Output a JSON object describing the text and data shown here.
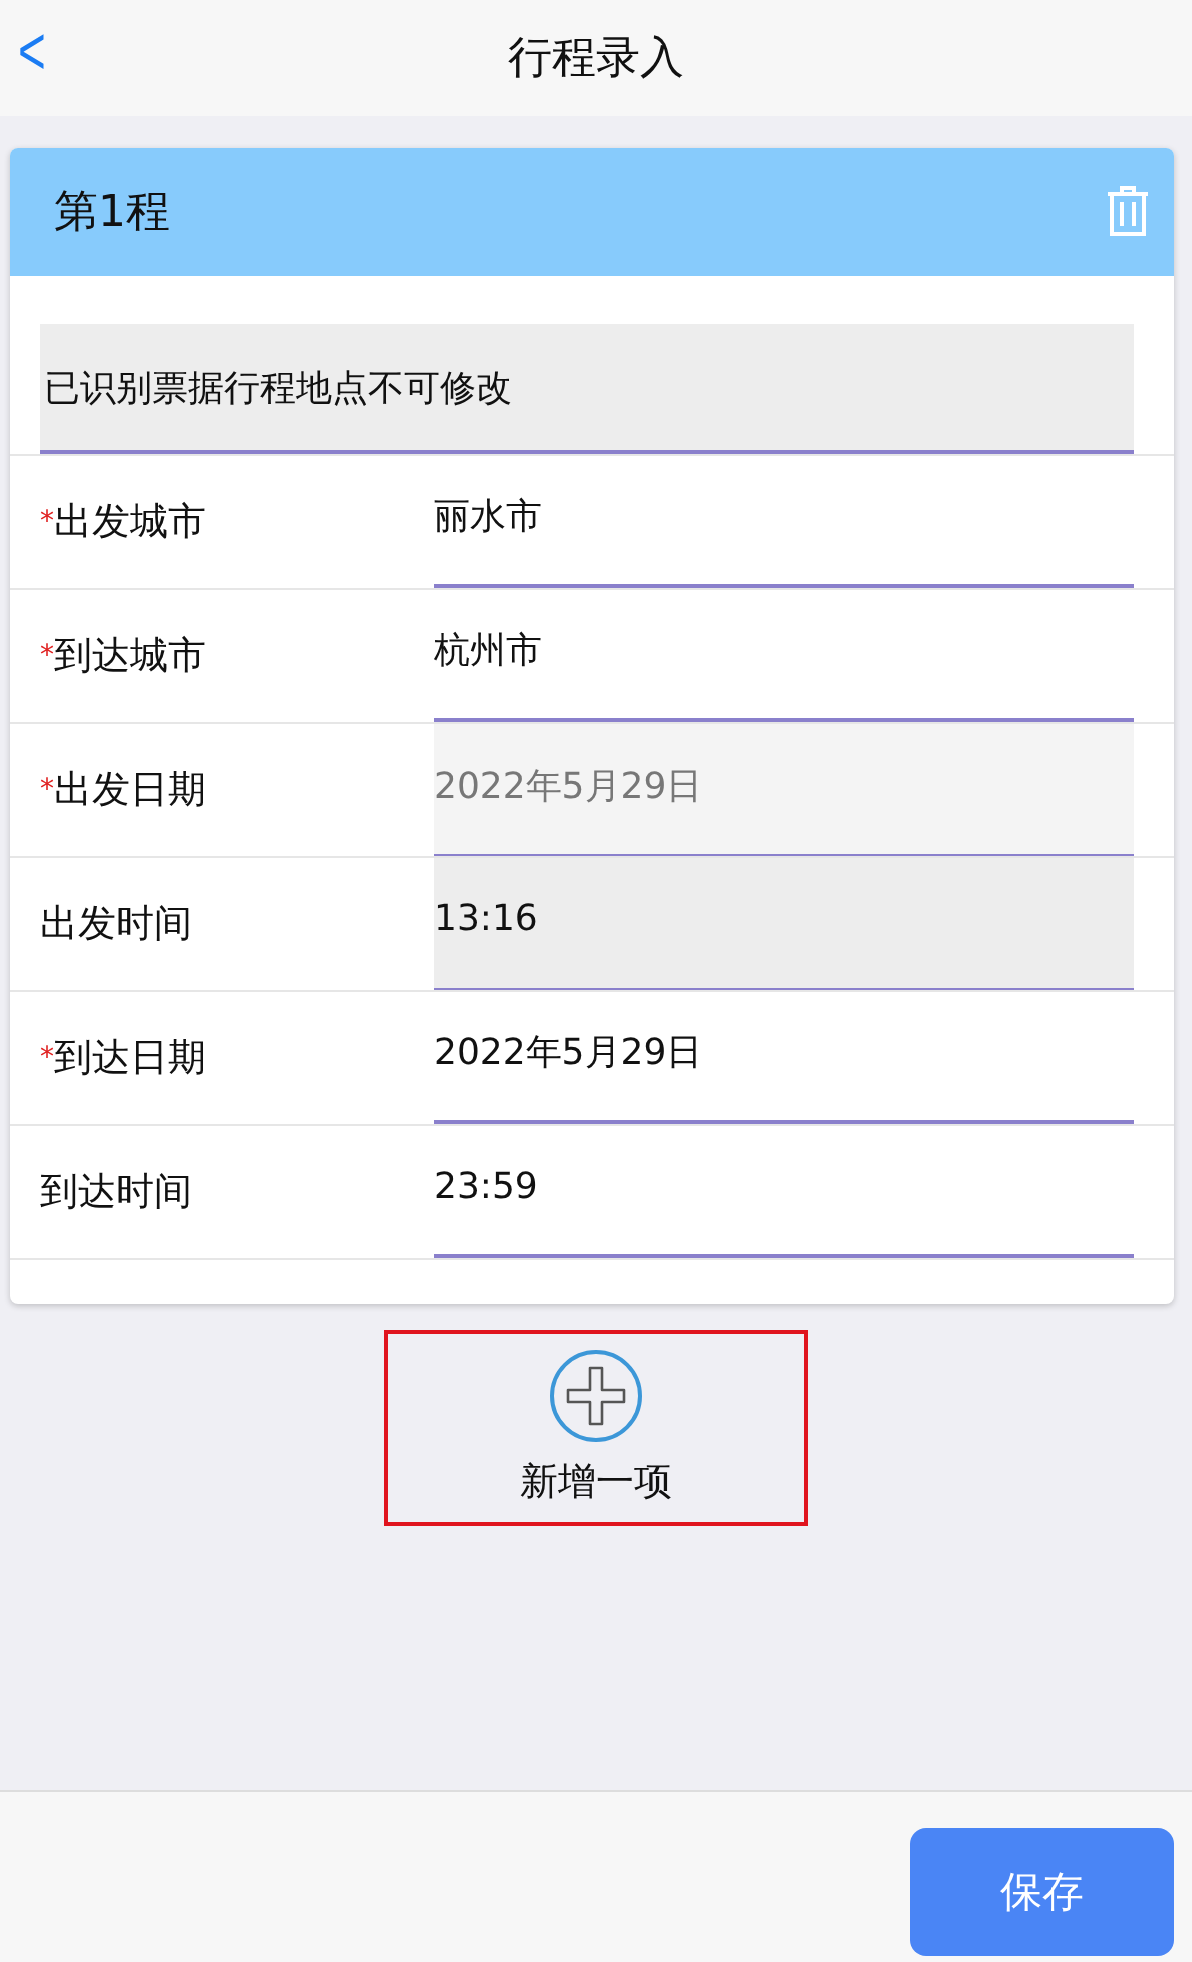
{
  "nav": {
    "back": "<",
    "title": "行程录入"
  },
  "trip": {
    "title": "第1程",
    "notice": "已识别票据行程地点不可修改",
    "fields": [
      {
        "marker": "*",
        "label": "出发城市",
        "value": "丽水市",
        "disabled": false,
        "locked": false
      },
      {
        "marker": "*",
        "label": "到达城市",
        "value": "杭州市",
        "disabled": false,
        "locked": false
      },
      {
        "marker": "*",
        "label": "出发日期",
        "value": "2022年5月29日",
        "disabled": true,
        "locked": false
      },
      {
        "label": "出发时间",
        "value": "13:16",
        "disabled": false,
        "locked": true
      },
      {
        "marker": "*",
        "label": "到达日期",
        "value": "2022年5月29日",
        "disabled": false,
        "locked": false
      },
      {
        "label": "到达时间",
        "value": "23:59",
        "disabled": false,
        "locked": false
      }
    ]
  },
  "add_button": {
    "label": "新增一项",
    "highlighted": true
  },
  "save_button": "保存"
}
